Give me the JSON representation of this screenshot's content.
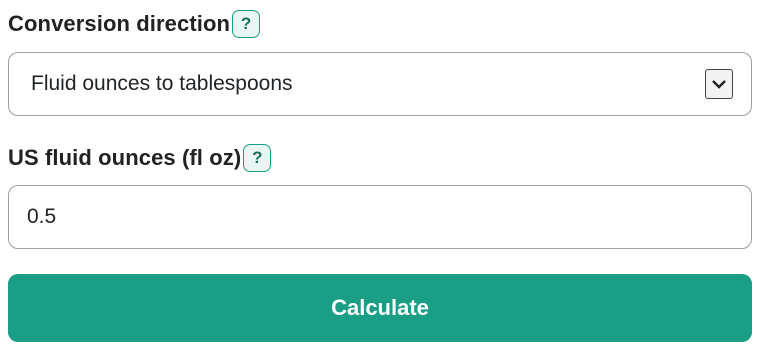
{
  "direction": {
    "label": "Conversion direction",
    "help": "?",
    "selected": "Fluid ounces to tablespoons",
    "arrow_icon": "chevron-down-icon"
  },
  "amount": {
    "label": "US fluid ounces (fl oz)",
    "help": "?",
    "value": "0.5"
  },
  "calculate": {
    "label": "Calculate"
  },
  "colors": {
    "accent": "#1a9e85",
    "badge_bg": "#e9f6f3",
    "border": "#9aa0a4"
  }
}
